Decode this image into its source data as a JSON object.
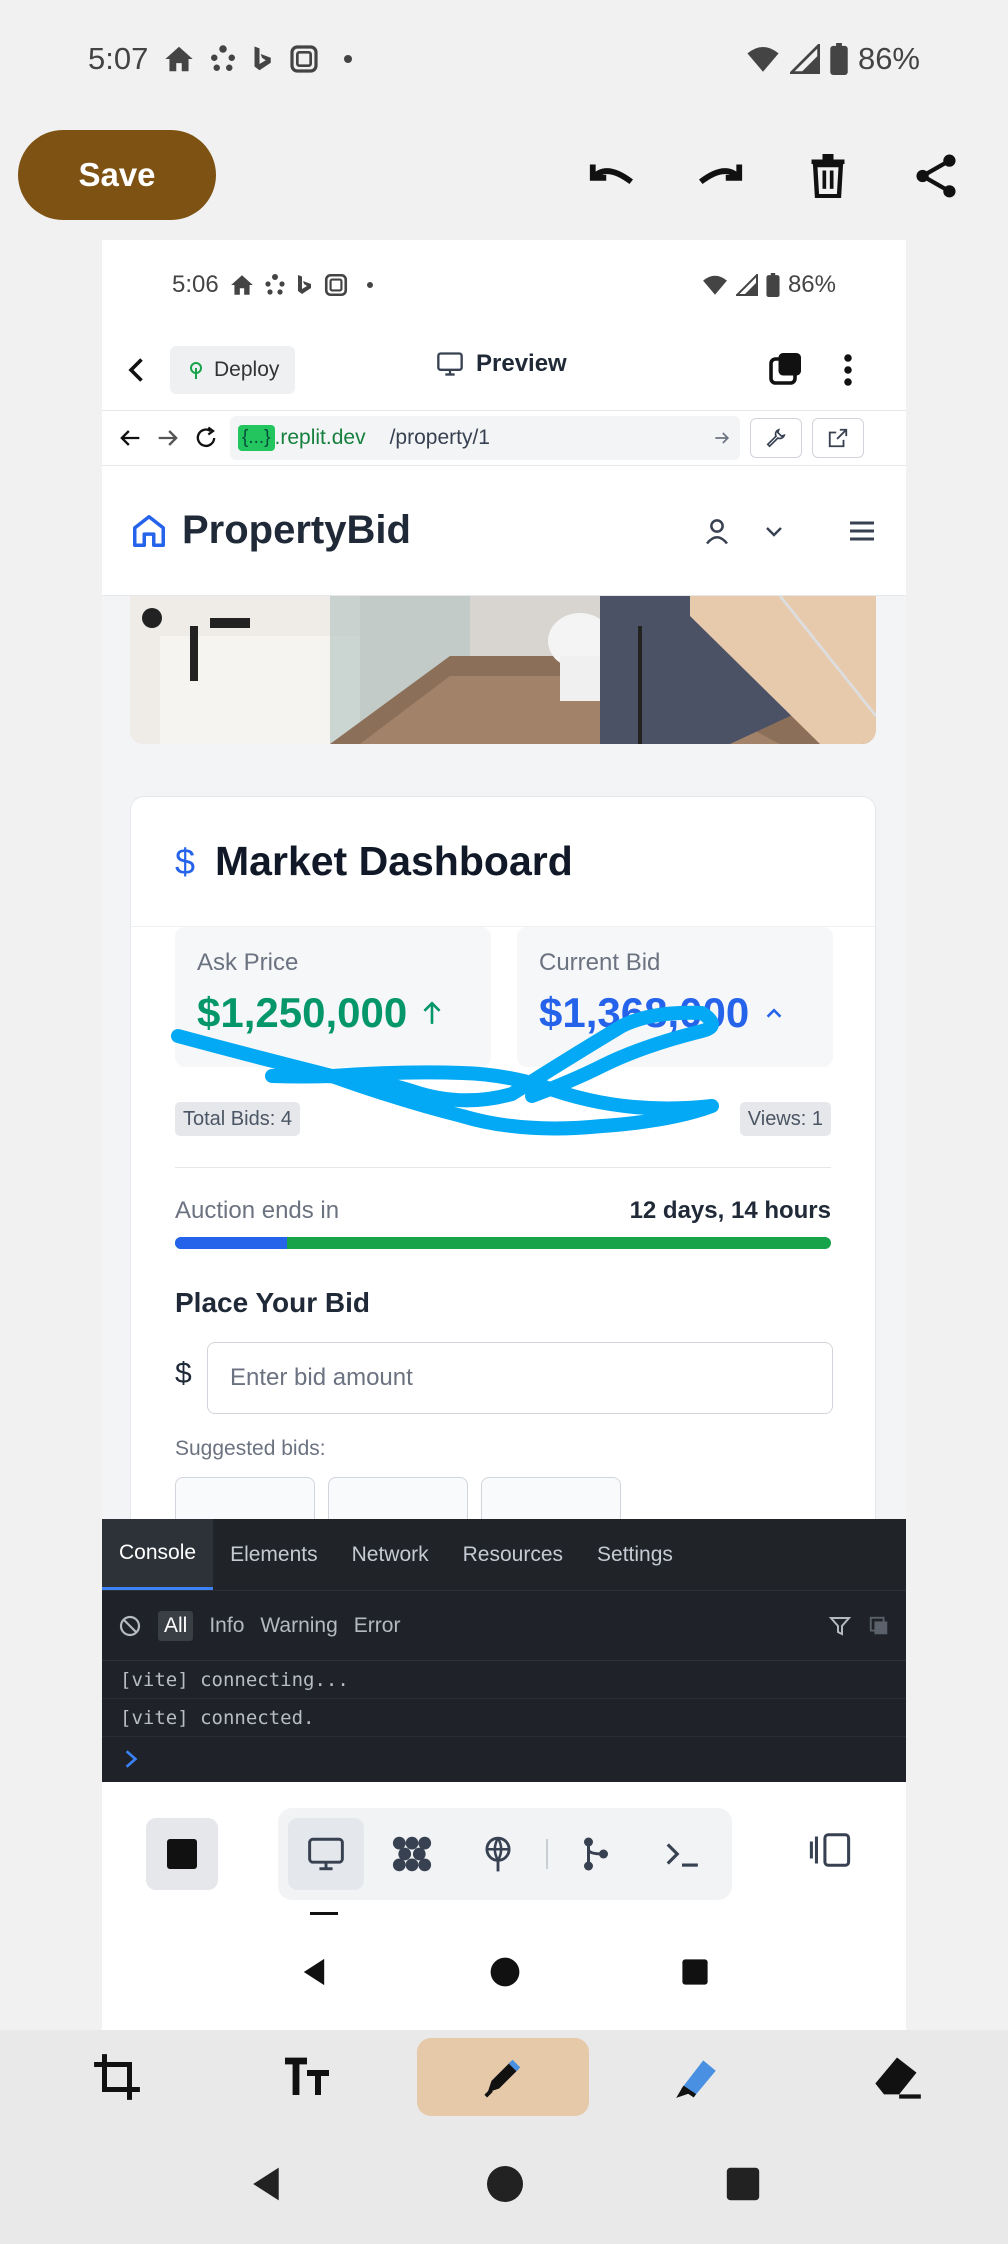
{
  "status_outer": {
    "time": "5:07",
    "battery": "86%"
  },
  "editor": {
    "save_label": "Save"
  },
  "inner_status": {
    "time": "5:06",
    "battery": "86%"
  },
  "replit_top": {
    "deploy_label": "Deploy",
    "preview_label": "Preview"
  },
  "urlbar": {
    "host_badge": "{...}",
    "domain": ".replit.dev",
    "path": "/property/1"
  },
  "site": {
    "brand": "PropertyBid",
    "dashboard_title": "Market Dashboard",
    "ask_label": "Ask Price",
    "ask_value": "$1,250,000",
    "bid_label": "Current Bid",
    "bid_value": "$1,368,000",
    "total_bids": "Total Bids: 4",
    "views": "Views: 1",
    "auction_label": "Auction ends in",
    "auction_value": "12 days, 14 hours",
    "auction_progress": 0.17,
    "place_bid_title": "Place Your Bid",
    "currency": "$",
    "bid_placeholder": "Enter bid amount",
    "suggested_label": "Suggested bids:"
  },
  "colors": {
    "ask": "#059669",
    "bid": "#2563eb",
    "save": "#7d5212",
    "scribble": "#03a9f4"
  },
  "devtools": {
    "tabs": [
      "Console",
      "Elements",
      "Network",
      "Resources",
      "Settings"
    ],
    "filters": [
      "All",
      "Info",
      "Warning",
      "Error"
    ],
    "logs": [
      "[vite] connecting...",
      "[vite] connected."
    ]
  }
}
